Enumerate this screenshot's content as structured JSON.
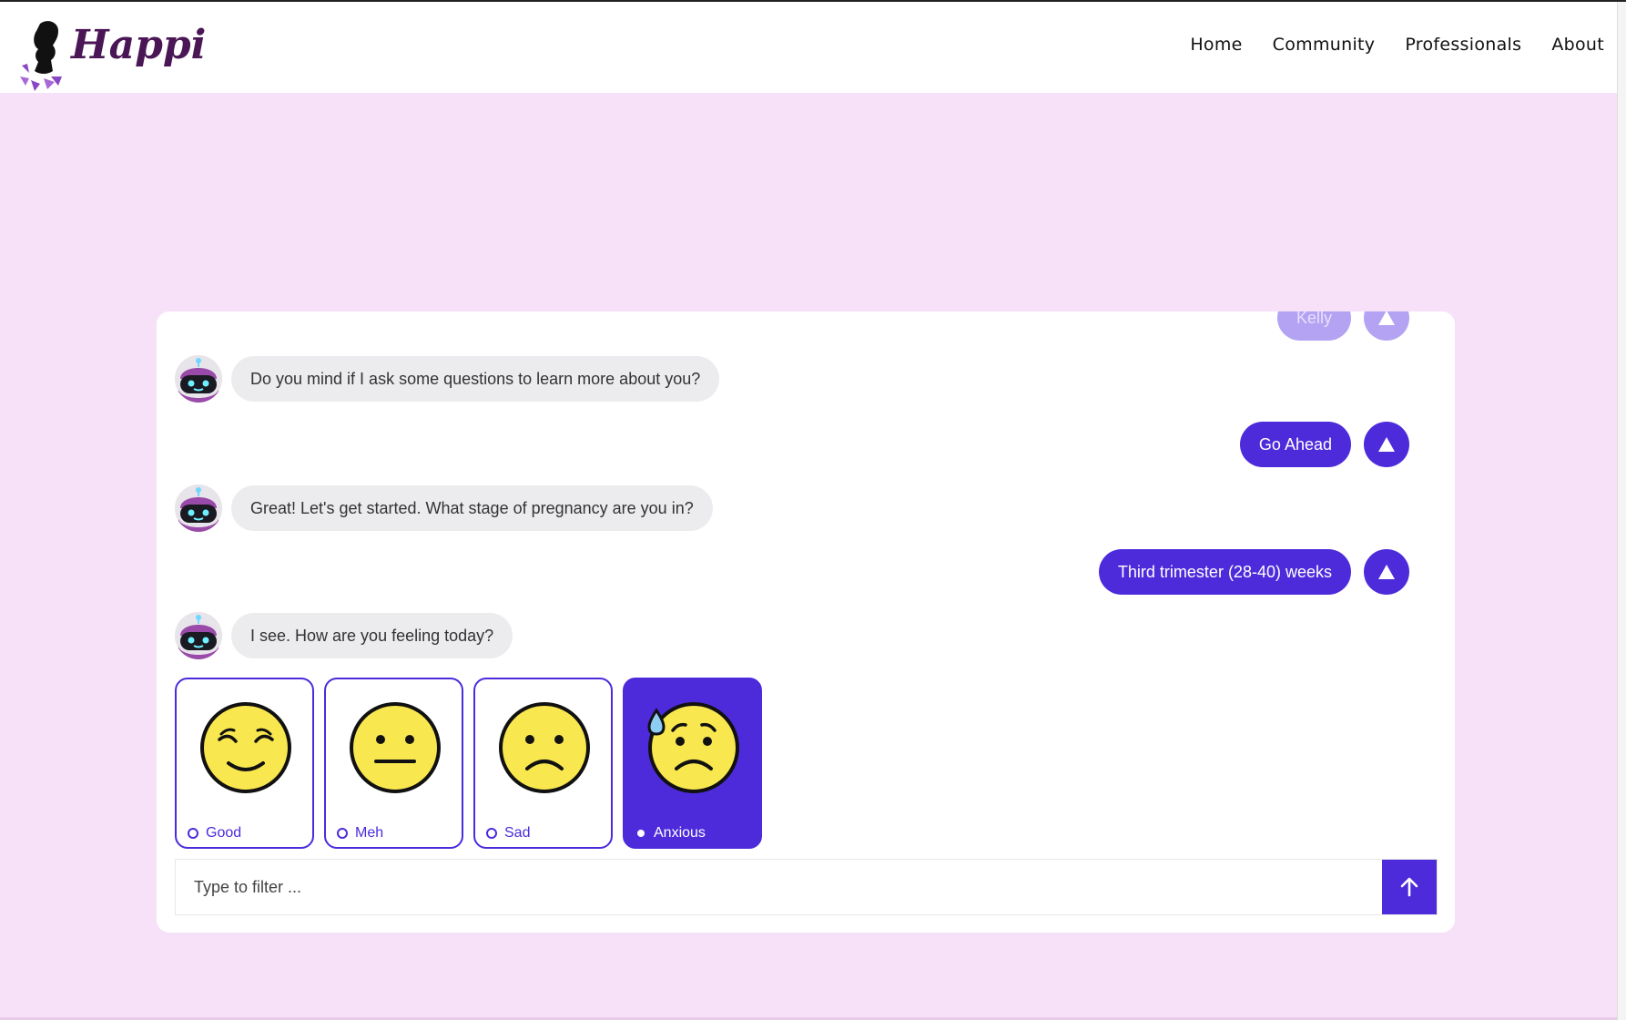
{
  "brand": {
    "name": "Happi"
  },
  "nav": {
    "items": [
      "Home",
      "Community",
      "Professionals",
      "About"
    ]
  },
  "chat": {
    "partial_user_reply": "Kelly",
    "messages": [
      {
        "from": "bot",
        "text": "Do you mind if I ask some questions to learn more about you?"
      },
      {
        "from": "user",
        "text": "Go Ahead"
      },
      {
        "from": "bot",
        "text": "Great! Let's get started. What stage of pregnancy are you in?"
      },
      {
        "from": "user",
        "text": "Third trimester (28-40) weeks"
      },
      {
        "from": "bot",
        "text": "I see. How are you feeling today?"
      }
    ]
  },
  "moods": {
    "options": [
      {
        "label": "Good",
        "icon": "relieved-face-icon",
        "selected": false
      },
      {
        "label": "Meh",
        "icon": "neutral-face-icon",
        "selected": false
      },
      {
        "label": "Sad",
        "icon": "frowning-face-icon",
        "selected": false
      },
      {
        "label": "Anxious",
        "icon": "anxious-sweat-face-icon",
        "selected": true
      }
    ]
  },
  "filter": {
    "placeholder": "Type to filter ..."
  },
  "colors": {
    "accent": "#4d2bdb",
    "page_background": "#f7e1f8",
    "bot_bubble": "#ececef",
    "emoji_yellow": "#f9e74f",
    "brand_text": "#4a1656"
  }
}
